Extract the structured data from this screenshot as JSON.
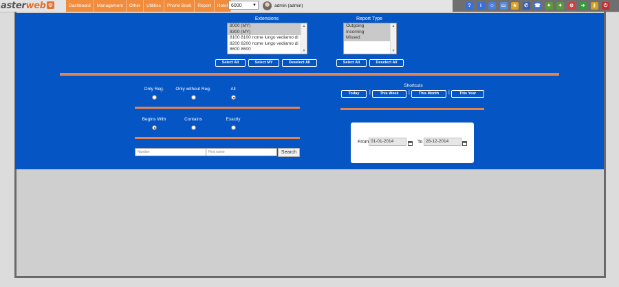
{
  "app": {
    "logo_text_a": "aster",
    "logo_text_b": "web",
    "logo_badge": "⚙"
  },
  "menu": [
    "Dashboard",
    "Management",
    "Other",
    "Utilities",
    "Phone Book",
    "Report",
    "Hotel"
  ],
  "header": {
    "extension_value": "6000",
    "user": "admin (admin)"
  },
  "toolbar_icons": [
    {
      "name": "help-icon",
      "glyph": "?",
      "color": "#3a6fd8"
    },
    {
      "name": "info-icon",
      "glyph": "i",
      "color": "#3a6fd8"
    },
    {
      "name": "user-icon",
      "glyph": "☺",
      "color": "#4a7fe0"
    },
    {
      "name": "monitor-icon",
      "glyph": "▭",
      "color": "#5a8ad8"
    },
    {
      "name": "star-icon",
      "glyph": "★",
      "color": "#e0a020"
    },
    {
      "name": "phone-icon",
      "glyph": "✆",
      "color": "#3a5fb0"
    },
    {
      "name": "handset-icon",
      "glyph": "☎",
      "color": "#4a6fc8"
    },
    {
      "name": "plug-icon",
      "glyph": "✦",
      "color": "#5a9a3a"
    },
    {
      "name": "plug2-icon",
      "glyph": "✦",
      "color": "#5a9a3a"
    },
    {
      "name": "block-icon",
      "glyph": "⊘",
      "color": "#d04040"
    },
    {
      "name": "arrow-icon",
      "glyph": "➜",
      "color": "#3a9a3a"
    },
    {
      "name": "key-icon",
      "glyph": "⚷",
      "color": "#d0a020"
    },
    {
      "name": "exit-icon",
      "glyph": "⏻",
      "color": "#c03030"
    }
  ],
  "extensions": {
    "title": "Extensions",
    "options": [
      {
        "label": "8000 (MY)",
        "selected": true
      },
      {
        "label": "8300 (MY)",
        "selected": true
      },
      {
        "label": "8100 8100 nome lungo vediamo di",
        "selected": false
      },
      {
        "label": "8200 8200 nome lungo vediamo di",
        "selected": false
      },
      {
        "label": "8600 8600",
        "selected": false
      }
    ],
    "select_all": "Select All",
    "select_my": "Select MY",
    "deselect_all": "Deselect All"
  },
  "report_type": {
    "title": "Report Type",
    "options": [
      {
        "label": "Outgoing",
        "selected": true
      },
      {
        "label": "Incoming",
        "selected": true
      },
      {
        "label": "Missed",
        "selected": true
      }
    ],
    "select_all": "Select All",
    "deselect_all": "Deselect All"
  },
  "registration": {
    "only_reg": "Only Reg.",
    "only_without_reg": "Only without Reg.",
    "all": "All"
  },
  "match": {
    "begins_with": "Begins With",
    "contains": "Contains",
    "exactly": "Exactly"
  },
  "shortcuts": {
    "title": "Shortcuts",
    "today": "Today",
    "this_week": "This Week",
    "this_month": "This Month",
    "this_year": "This Year",
    "sep": "|"
  },
  "search": {
    "number_placeholder": "Number",
    "name_placeholder": "First name",
    "button": "Search"
  },
  "dates": {
    "from_label": "From",
    "from_value": "01-01-2014",
    "to_label": "To",
    "to_value": "28-12-2014"
  },
  "colors": {
    "accent": "#f08c3c",
    "panel": "#0556c4",
    "divider": "#e7834a"
  }
}
